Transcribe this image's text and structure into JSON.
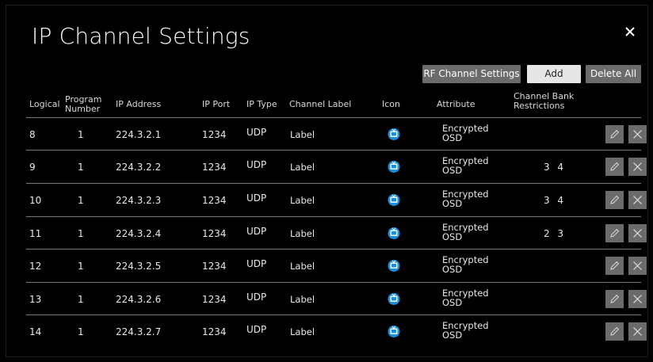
{
  "title": "IP Channel Settings",
  "buttons": {
    "rf": "RF Channel Settings",
    "add": "Add",
    "delete_all": "Delete All"
  },
  "headers": {
    "logical": "Logical",
    "program_1": "Program",
    "program_2": "Number",
    "ip_address": "IP Address",
    "ip_port": "IP Port",
    "ip_type": "IP Type",
    "channel_label": "Channel Label",
    "icon": "Icon",
    "attribute": "Attribute",
    "bank_1": "Channel Bank",
    "bank_2": "Restrictions"
  },
  "rows": [
    {
      "logical": "8",
      "program": "1",
      "ip": "224.3.2.1",
      "port": "1234",
      "type": "UDP",
      "label": "Label",
      "attr1": "Encrypted",
      "attr2": "OSD",
      "bank": ""
    },
    {
      "logical": "9",
      "program": "1",
      "ip": "224.3.2.2",
      "port": "1234",
      "type": "UDP",
      "label": "Label",
      "attr1": "Encrypted",
      "attr2": "OSD",
      "bank": "3 4"
    },
    {
      "logical": "10",
      "program": "1",
      "ip": "224.3.2.3",
      "port": "1234",
      "type": "UDP",
      "label": "Label",
      "attr1": "Encrypted",
      "attr2": "OSD",
      "bank": "3 4"
    },
    {
      "logical": "11",
      "program": "1",
      "ip": "224.3.2.4",
      "port": "1234",
      "type": "UDP",
      "label": "Label",
      "attr1": "Encrypted",
      "attr2": "OSD",
      "bank": "2 3"
    },
    {
      "logical": "12",
      "program": "1",
      "ip": "224.3.2.5",
      "port": "1234",
      "type": "UDP",
      "label": "Label",
      "attr1": "Encrypted",
      "attr2": "OSD",
      "bank": ""
    },
    {
      "logical": "13",
      "program": "1",
      "ip": "224.3.2.6",
      "port": "1234",
      "type": "UDP",
      "label": "Label",
      "attr1": "Encrypted",
      "attr2": "OSD",
      "bank": ""
    },
    {
      "logical": "14",
      "program": "1",
      "ip": "224.3.2.7",
      "port": "1234",
      "type": "UDP",
      "label": "Label",
      "attr1": "Encrypted",
      "attr2": "OSD",
      "bank": ""
    }
  ],
  "icons": {
    "close": "close-icon",
    "tv": "tv-icon",
    "edit": "pencil-icon",
    "delete": "x-icon"
  },
  "colors": {
    "background": "#000000",
    "button_gray": "#6b6b6b",
    "button_light": "#e6e6e6",
    "icon_blue": "#1a8fe0",
    "divider": "#7a7a7a"
  }
}
